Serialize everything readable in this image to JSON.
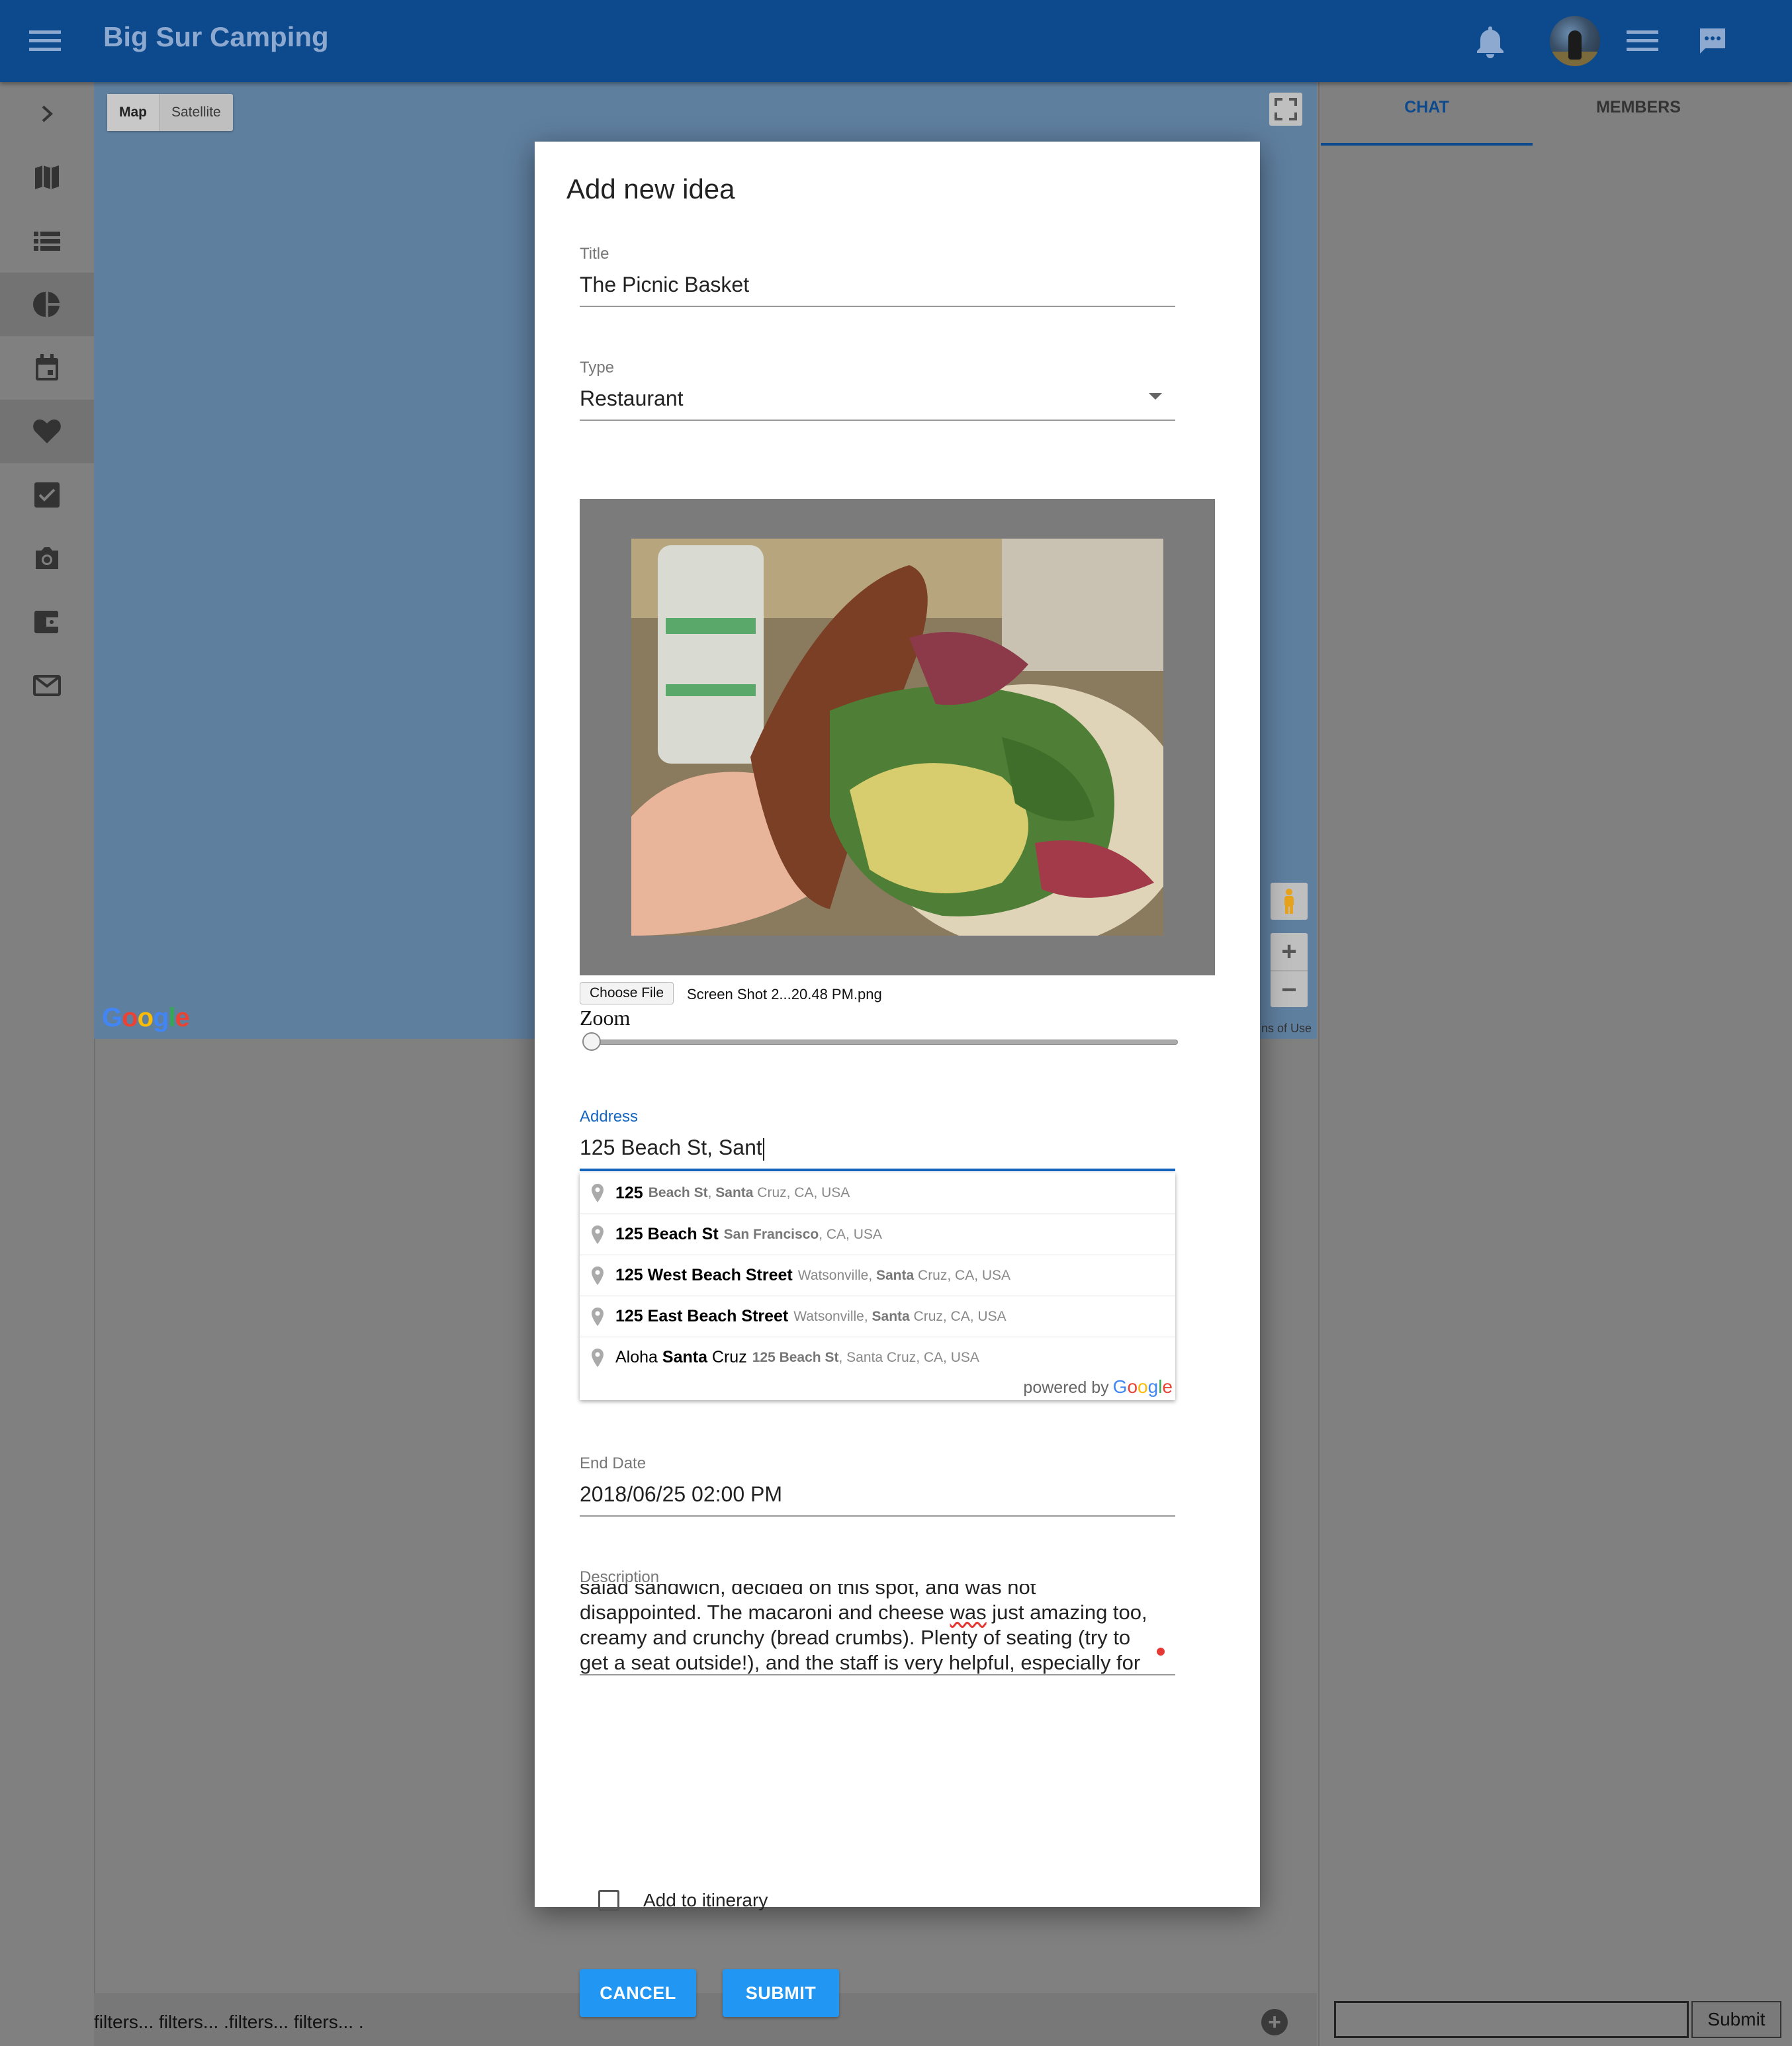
{
  "app": {
    "title": "Big Sur Camping"
  },
  "colors": {
    "topbar": "#0d4a8d",
    "accent": "#2196f3",
    "focus": "#1565c0"
  },
  "header": {
    "icons": [
      "menu-icon",
      "bell-icon",
      "avatar",
      "list-icon",
      "chat-icon"
    ]
  },
  "sidebar": {
    "items": [
      {
        "icon": "chevron-right-icon"
      },
      {
        "icon": "map-icon"
      },
      {
        "icon": "list-icon"
      },
      {
        "icon": "pie-chart-icon",
        "active": true
      },
      {
        "icon": "calendar-icon"
      },
      {
        "icon": "heart-icon",
        "active": true
      },
      {
        "icon": "checkbox-icon"
      },
      {
        "icon": "camera-icon"
      },
      {
        "icon": "wallet-icon"
      },
      {
        "icon": "mail-icon"
      }
    ]
  },
  "map": {
    "type_map": "Map",
    "type_satellite": "Satellite",
    "terms": "ns of Use"
  },
  "panel": {
    "tab_chat": "CHAT",
    "tab_members": "MEMBERS",
    "submit": "Submit"
  },
  "footer": {
    "filters": "filters... filters... .filters... filters... ."
  },
  "modal": {
    "title": "Add new idea",
    "title_label": "Title",
    "title_value": "The Picnic Basket",
    "type_label": "Type",
    "type_value": "Restaurant",
    "file_button": "Choose File",
    "file_name": "Screen Shot 2...20.48 PM.png",
    "zoom_label": "Zoom",
    "zoom_level": 0,
    "address_label": "Address",
    "address_value": "125 Beach St, Sant",
    "end_date_label": "End Date",
    "end_date_value": "2018/06/25 02:00 PM",
    "description_label": "Description",
    "description_lines": [
      "salad sandwich, decided on this spot, and was not",
      "disappointed. The macaroni and cheese ",
      "was",
      " just amazing too,",
      "creamy and crunchy (bread crumbs). Plenty of seating (try to",
      "get a seat outside!), and the staff is very helpful, especially for"
    ],
    "itinerary_label": "Add to itinerary",
    "itinerary_checked": false,
    "cancel": "CANCEL",
    "submit": "SUBMIT"
  },
  "autocomplete": {
    "suggestions": [
      {
        "main_bold": "125",
        "main_rest": "",
        "sec_bold": "Beach St",
        "sec_mid": ", ",
        "sec_bold2": "Santa",
        "sec_rest": " Cruz, CA, USA"
      },
      {
        "main_bold": "125 Beach St",
        "main_rest": "",
        "sec_bold": "San Francisco",
        "sec_mid": ", CA, USA",
        "sec_bold2": "",
        "sec_rest": ""
      },
      {
        "main_bold": "125 West Beach Street",
        "main_rest": "",
        "sec_bold": "",
        "sec_mid": "Watsonville, ",
        "sec_bold2": "Santa",
        "sec_rest": " Cruz, CA, USA"
      },
      {
        "main_bold": "125 East Beach Street",
        "main_rest": "",
        "sec_bold": "",
        "sec_mid": "Watsonville, ",
        "sec_bold2": "Santa",
        "sec_rest": " Cruz, CA, USA"
      },
      {
        "main_bold": "",
        "main_rest": "Aloha ",
        "main_bold_b": "Santa",
        "main_rest_b": " Cruz",
        "sec_bold": "125 Beach St",
        "sec_mid": ", Santa Cruz, CA, USA",
        "sec_bold2": "",
        "sec_rest": ""
      }
    ],
    "powered_by": "powered by"
  }
}
